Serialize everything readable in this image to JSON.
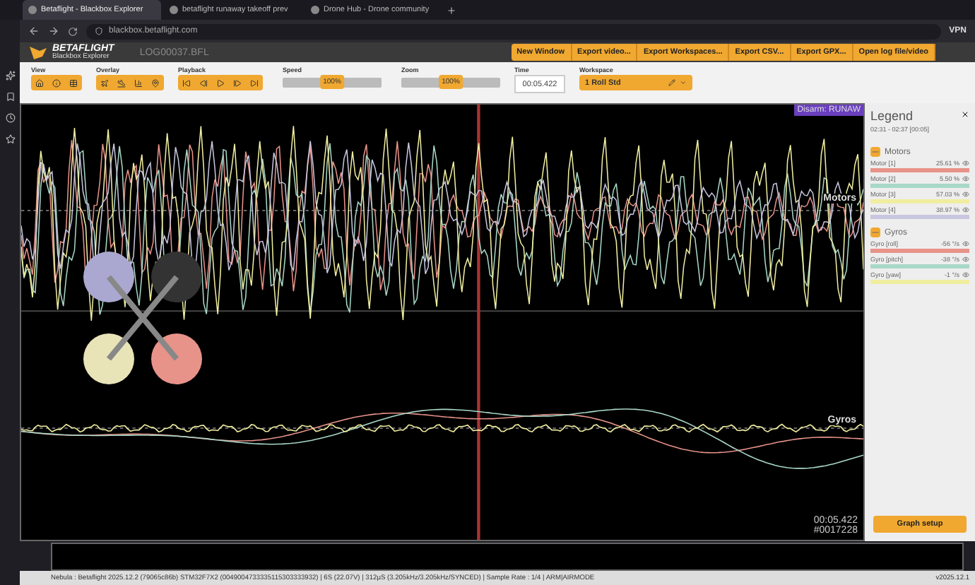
{
  "browser": {
    "tabs": [
      {
        "title": "Betaflight - Blackbox Explorer",
        "selected": true
      },
      {
        "title": "betaflight runaway takeoff prev",
        "selected": false
      },
      {
        "title": "Drone Hub - Drone community",
        "selected": false
      }
    ],
    "address": "blackbox.betaflight.com",
    "vpn": "VPN"
  },
  "header": {
    "logo_title": "BETAFLIGHT",
    "logo_subtitle": "Blackbox Explorer",
    "file_name": "LOG00037.BFL",
    "buttons": [
      "New Window",
      "Export video...",
      "Export Workspaces...",
      "Export CSV...",
      "Export GPX...",
      "Open log file/video"
    ]
  },
  "toolbar": {
    "view_label": "View",
    "overlay_label": "Overlay",
    "playback_label": "Playback",
    "speed": {
      "label": "Speed",
      "level": 0.5,
      "reading": "100%"
    },
    "zoom": {
      "label": "Zoom",
      "level": 0.5,
      "reading": "100%"
    },
    "time": {
      "label": "Time",
      "value": "00:05.422"
    },
    "workspace": {
      "label": "Workspace",
      "value": "1 Roll Std"
    }
  },
  "graph": {
    "event_label": "Disarm: RUNAW",
    "groups": [
      "Motors",
      "Gyros"
    ],
    "time": "00:05.422",
    "frame": "#0017228"
  },
  "legend": {
    "title": "Legend",
    "range": "02:31 - 02:37 [00:05]",
    "groups": [
      {
        "name": "Motors",
        "items": [
          {
            "name": "Motor [1]",
            "value": "25.61 %",
            "color": "#e8938a"
          },
          {
            "name": "Motor [2]",
            "value": "5.50 %",
            "color": "#a8d8c8"
          },
          {
            "name": "Motor [3]",
            "value": "57.03 %",
            "color": "#f0eea0"
          },
          {
            "name": "Motor [4]",
            "value": "38.97 %",
            "color": "#c8c6e0"
          }
        ]
      },
      {
        "name": "Gyros",
        "items": [
          {
            "name": "Gyro [roll]",
            "value": "-56 °/s",
            "color": "#e8938a"
          },
          {
            "name": "Gyro [pitch]",
            "value": "-38 °/s",
            "color": "#a8d8c8"
          },
          {
            "name": "Gyro [yaw]",
            "value": "-1 °/s",
            "color": "#f0eea0"
          }
        ]
      }
    ],
    "setup_button": "Graph setup"
  },
  "status_bar": {
    "text": "Nebula : Betaflight 2025.12.2 (79065c86b) STM32F7X2 (0049004733335115303333932) | 6S (22.07V) | 312µS (3.205kHz/3.205kHz/SYNCED) | Sample Rate : 1/4 | ARM|AIRMODE",
    "version": "v2025.12.1"
  }
}
